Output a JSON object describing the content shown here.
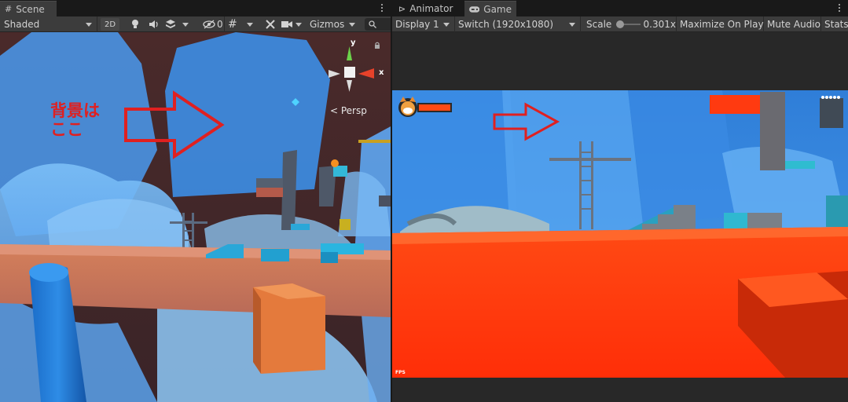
{
  "colors": {
    "editor_bg": "#282828",
    "toolbar_bg": "#3c3c3c",
    "tab_bg": "#191919",
    "annotation_red": "#e02020",
    "game_orange": "#ff3a10",
    "sky_blue": "#3a8de0"
  },
  "scene_panel": {
    "tab_label": "Scene",
    "tab_icon": "hash-grid-icon",
    "toolbar": {
      "shading_mode": "Shaded",
      "mode_2d": "2D",
      "hidden_count": "0",
      "gizmos_label": "Gizmos",
      "search_icon": "search-icon"
    },
    "gizmo": {
      "x_label": "x",
      "y_label": "y",
      "persp_label": "< Persp"
    },
    "annotation_text": "背景は\nここ"
  },
  "game_panel": {
    "tabs": [
      {
        "label": "Animator",
        "icon": "animator-icon"
      },
      {
        "label": "Game",
        "icon": "gamepad-icon"
      }
    ],
    "toolbar": {
      "display": "Display 1",
      "resolution": "Switch (1920x1080)",
      "scale_label": "Scale",
      "scale_value": "0.301x",
      "maximize": "Maximize On Play",
      "mute": "Mute Audio",
      "stats": "Stats"
    },
    "hud": {
      "fps_label": "FPS",
      "health_fraction": 1.0
    }
  }
}
